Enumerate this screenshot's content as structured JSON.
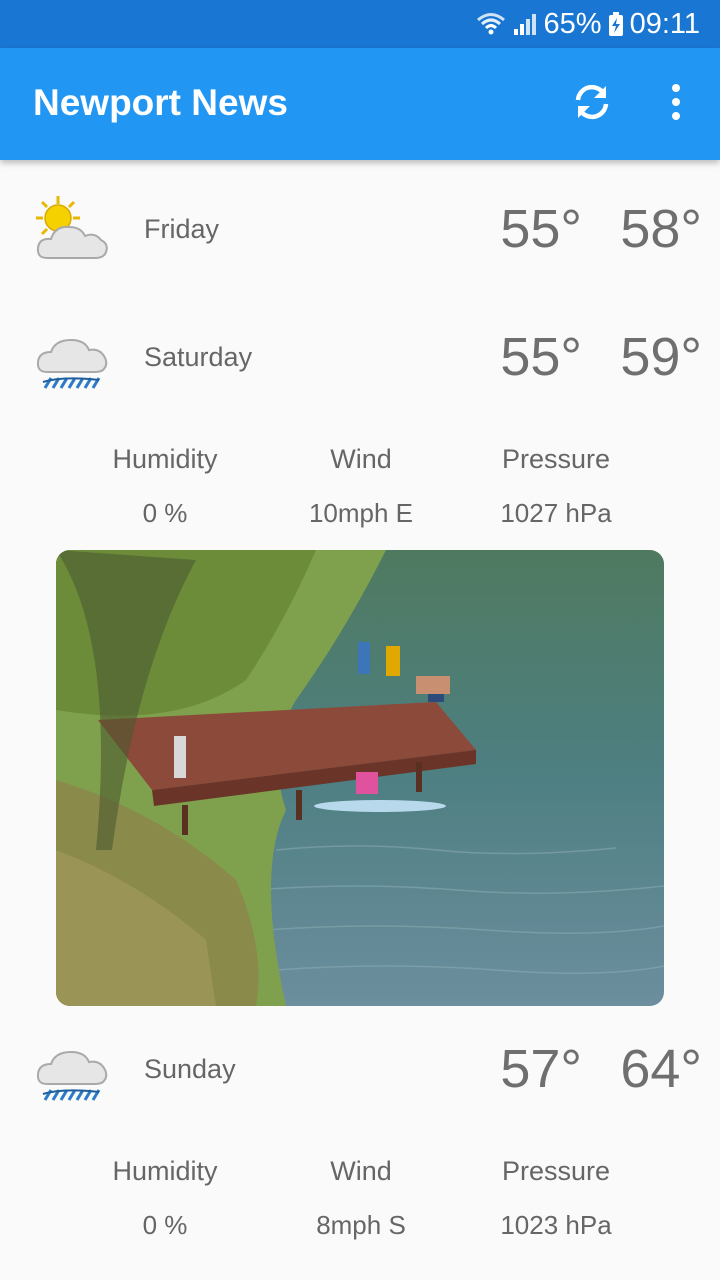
{
  "status_bar": {
    "battery": "65%",
    "time": "09:11",
    "icons": [
      "wifi-icon",
      "signal-icon",
      "battery-charging-icon"
    ]
  },
  "app_bar": {
    "title": "Newport News",
    "actions": [
      "refresh-icon",
      "more-vert-icon"
    ]
  },
  "days": [
    {
      "day": "Friday",
      "icon": "partly-cloudy-icon",
      "low": "55°",
      "high": "58°"
    },
    {
      "day": "Saturday",
      "icon": "rain-icon",
      "low": "55°",
      "high": "59°",
      "details": {
        "humidity_label": "Humidity",
        "humidity": "0 %",
        "wind_label": "Wind",
        "wind": "10mph E",
        "pressure_label": "Pressure",
        "pressure": "1027 hPa"
      }
    },
    {
      "day": "Sunday",
      "icon": "rain-icon",
      "low": "57°",
      "high": "64°",
      "details": {
        "humidity_label": "Humidity",
        "humidity": "0 %",
        "wind_label": "Wind",
        "wind": "8mph S",
        "pressure_label": "Pressure",
        "pressure": "1023 hPa"
      }
    }
  ],
  "colors": {
    "status_bar": "#1976d2",
    "app_bar": "#2196f3",
    "background": "#fafafa",
    "text": "#666666"
  },
  "photo": {
    "icon": "lake-dock-photo"
  }
}
